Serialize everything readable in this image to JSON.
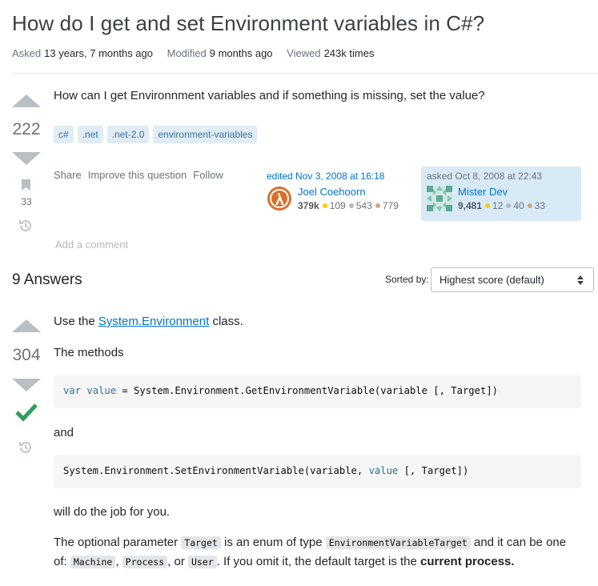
{
  "question": {
    "title": "How do I get and set Environment variables in C#?",
    "meta": [
      {
        "label": "Asked",
        "value": "13 years, 7 months ago"
      },
      {
        "label": "Modified",
        "value": "9 months ago"
      },
      {
        "label": "Viewed",
        "value": "243k times"
      }
    ],
    "score": "222",
    "bookmark_count": "33",
    "body": "How can I get Environnment variables and if something is missing, set the value?",
    "tags": [
      "c#",
      ".net",
      ".net-2.0",
      "environment-variables"
    ],
    "menu": [
      "Share",
      "Improve this question",
      "Follow"
    ],
    "edited": {
      "action": "edited Nov 3, 2008 at 16:18",
      "user": "Joel Coehoorn",
      "reputation": "379k",
      "gold": "109",
      "silver": "543",
      "bronze": "779"
    },
    "asked": {
      "action": "asked Oct 8, 2008 at 22:43",
      "user": "Mister Dev",
      "reputation": "9,481",
      "gold": "12",
      "silver": "40",
      "bronze": "33"
    },
    "add_comment": "Add a comment"
  },
  "answers_header": {
    "count_label": "9 Answers",
    "sorted_by_label": "Sorted by:",
    "sort_value": "Highest score (default)"
  },
  "answer": {
    "score": "304",
    "accepted": true,
    "p1_prefix": "Use the",
    "p1_link": "System.Environment",
    "p1_suffix": "class.",
    "p2": "The methods",
    "code1_kw": "var",
    "code1_mid": "value",
    "code1_rest": "= System.Environment.GetEnvironmentVariable(variable [, Target])",
    "p3": "and",
    "code2_pre": "System.Environment.SetEnvironmentVariable(variable,",
    "code2_kw": "value",
    "code2_post": "[, Target])",
    "p4": "will do the job for you.",
    "p5_a": "The optional parameter",
    "p5_code1": "Target",
    "p5_b": "is an enum of type",
    "p5_code2": "EnvironmentVariableTarget",
    "p5_c": "and it can be one of:",
    "p5_code3": "Machine",
    "p5_d": ",",
    "p5_code4": "Process",
    "p5_e": ", or",
    "p5_code5": "User",
    "p5_f": ". If you omit it, the default target is the",
    "p5_bold": "current process."
  },
  "colors": {
    "link": "#0074cc",
    "tag_bg": "#e1ecf4",
    "tag_text": "#39739d",
    "accepted_check": "#2f9e5a",
    "asked_card_bg": "#d9eaf7"
  }
}
